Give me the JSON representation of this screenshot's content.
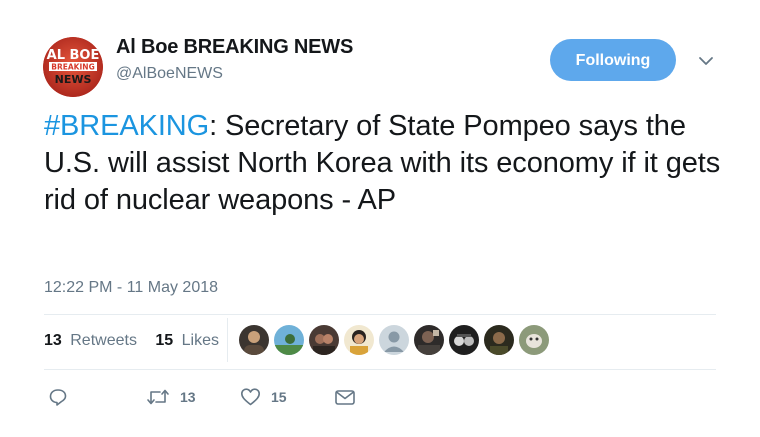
{
  "profile": {
    "display_name": "Al Boe BREAKING NEWS",
    "handle": "@AlBoeNEWS",
    "avatar_logo_lines": [
      "AL BOE",
      "BREAKING",
      "NEWS"
    ]
  },
  "follow_button": {
    "label": "Following"
  },
  "tweet": {
    "hashtag": "#BREAKING",
    "body": ": Secretary of State Pompeo says the U.S. will assist North Korea with its economy if it gets rid of nuclear weapons - AP",
    "timestamp": "12:22 PM - 11 May 2018"
  },
  "stats": {
    "retweets_count": "13",
    "retweets_label": "Retweets",
    "likes_count": "15",
    "likes_label": "Likes"
  },
  "likers": [
    {
      "icon": "user-avatar"
    },
    {
      "icon": "user-avatar"
    },
    {
      "icon": "user-avatar"
    },
    {
      "icon": "user-avatar"
    },
    {
      "icon": "default-avatar"
    },
    {
      "icon": "user-avatar"
    },
    {
      "icon": "user-avatar"
    },
    {
      "icon": "user-avatar"
    },
    {
      "icon": "user-avatar"
    }
  ],
  "actions": {
    "reply": {
      "icon": "reply-icon"
    },
    "retweet": {
      "icon": "retweet-icon",
      "count": "13"
    },
    "like": {
      "icon": "heart-icon",
      "count": "15"
    },
    "message": {
      "icon": "envelope-icon"
    }
  },
  "colors": {
    "accent": "#1b95e0",
    "follow_button_bg": "#5ea8ec",
    "secondary_text": "#657786",
    "avatar_red": "#d73a2c"
  }
}
